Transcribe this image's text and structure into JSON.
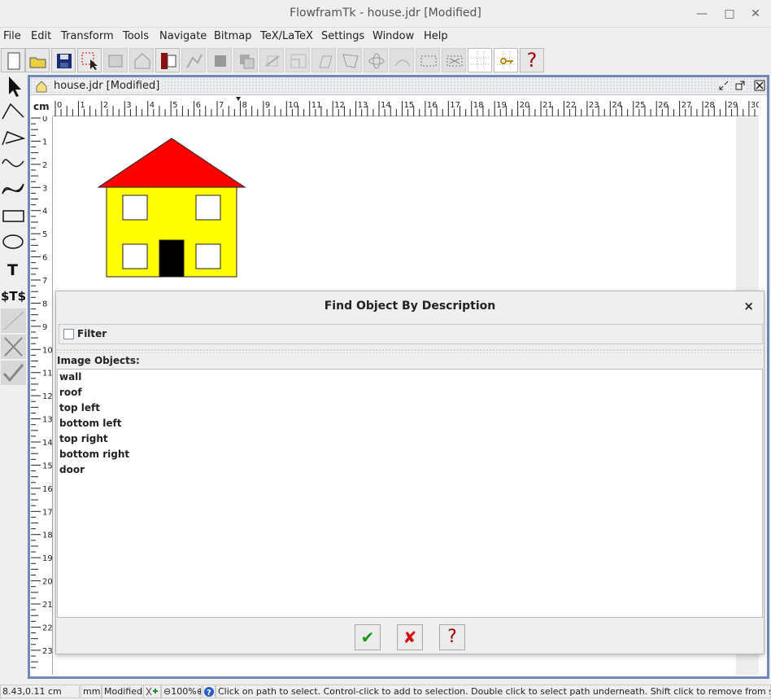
{
  "window": {
    "title": "FlowframTk - house.jdr [Modified]",
    "controls": [
      "minimize-icon",
      "maximize-icon",
      "close-icon"
    ]
  },
  "menu": [
    "File",
    "Edit",
    "Transform",
    "Tools",
    "Navigate",
    "Bitmap",
    "TeX/LaTeX",
    "Settings",
    "Window",
    "Help"
  ],
  "toolbar": {
    "help_glyph": "?"
  },
  "document": {
    "title": "house.jdr [Modified]",
    "ruler_unit": "cm",
    "hruler_ticks": [
      "0",
      "1",
      "2",
      "3",
      "4",
      "5",
      "6",
      "7",
      "8",
      "9",
      "10",
      "11",
      "12",
      "13",
      "14",
      "15",
      "16",
      "17",
      "18",
      "19",
      "20",
      "21",
      "22",
      "23",
      "24",
      "25",
      "26",
      "27",
      "28",
      "29",
      "30"
    ],
    "vruler_ticks": [
      "0",
      "1",
      "2",
      "3",
      "4",
      "5",
      "6",
      "7",
      "8",
      "9",
      "10",
      "11",
      "12",
      "13",
      "14",
      "15",
      "16",
      "17",
      "18",
      "19",
      "20",
      "21",
      "22",
      "23"
    ]
  },
  "dialog": {
    "title": "Find Object By Description",
    "close_glyph": "×",
    "filter_label": "Filter",
    "filter_checked": false,
    "objects_label": "Image Objects:",
    "objects": [
      "wall",
      "roof",
      "top left",
      "bottom left",
      "top right",
      "bottom right",
      "door"
    ],
    "ok_glyph": "✔",
    "cancel_glyph": "✘",
    "help_glyph": "?"
  },
  "status": {
    "position": "8.43,0.11 cm",
    "unit": "mm",
    "modified": "Modified",
    "zoom": "100%",
    "message": "Click on path to select. Control-click to add to selection. Double click to select path underneath. Shift click to remove from selection."
  },
  "colors": {
    "roof": "#ff0000",
    "wall": "#ffff00",
    "door": "#000000",
    "frame_border": "#6f8ab7",
    "ok": "#1a9a1a",
    "cancel": "#d01010",
    "help": "#a00000"
  }
}
